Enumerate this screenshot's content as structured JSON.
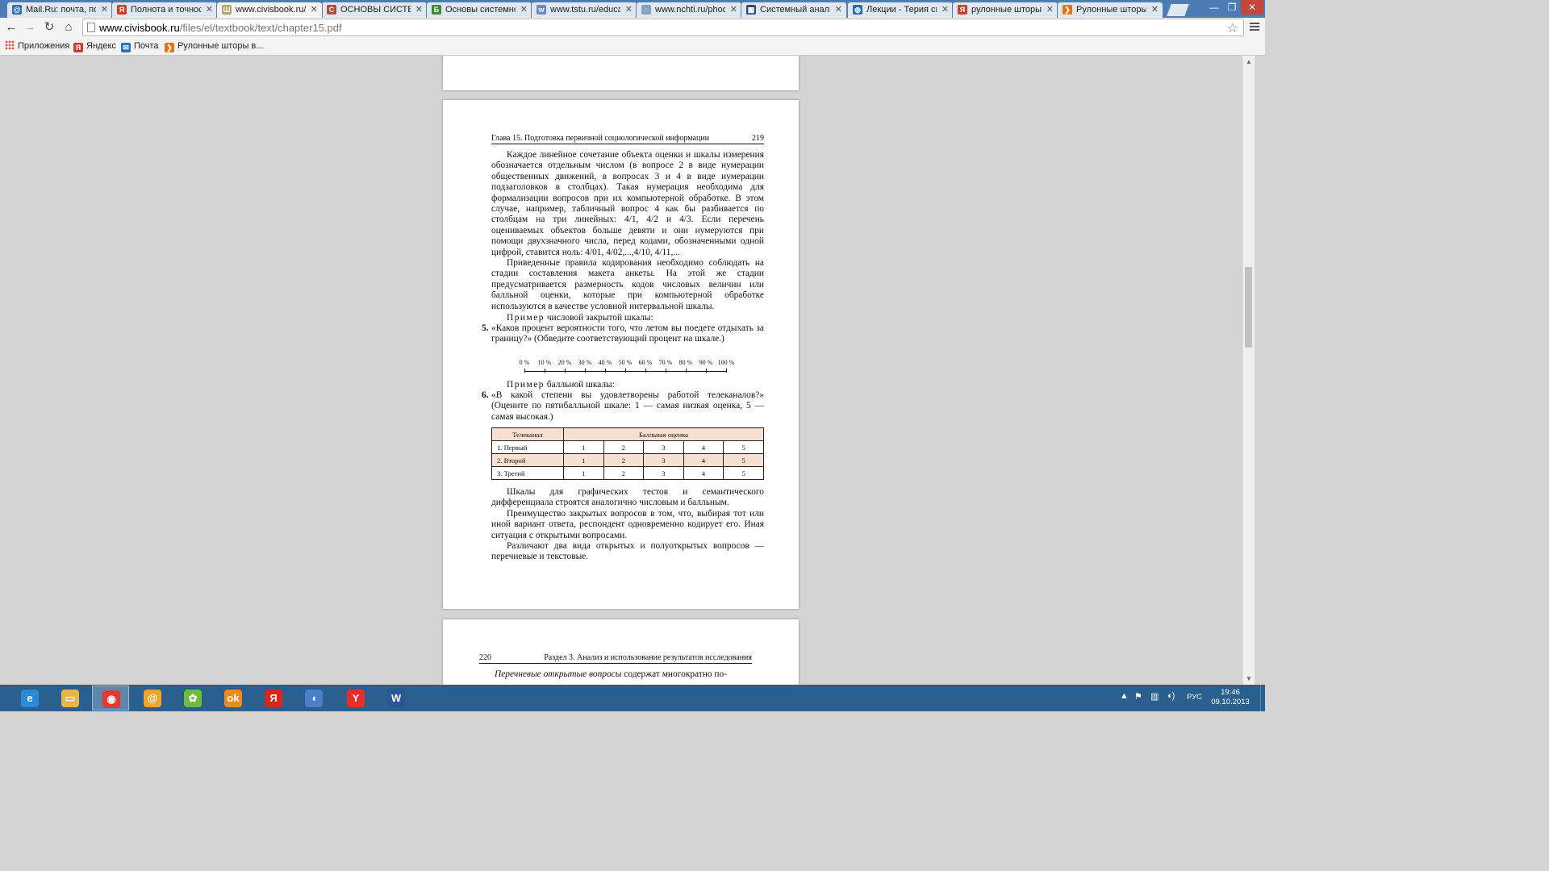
{
  "browser": {
    "tabs": [
      {
        "label": "Mail.Ru: почта, пои",
        "color": "#2f6fb5",
        "glyph": "@"
      },
      {
        "label": "Полнота и точност",
        "color": "#d43a2a",
        "glyph": "Я"
      },
      {
        "label": "www.civisbook.ru/f",
        "color": "#b7a26a",
        "glyph": "Ш"
      },
      {
        "label": "ОСНОВЫ СИСТЕМ",
        "color": "#b14a3d",
        "glyph": "С"
      },
      {
        "label": "Основы системног",
        "color": "#3d8d2f",
        "glyph": "Б"
      },
      {
        "label": "www.tstu.ru/educat",
        "color": "#6d89c7",
        "glyph": "w"
      },
      {
        "label": "www.nchti.ru/phoc",
        "color": "#8aa0c0",
        "glyph": "◌"
      },
      {
        "label": "Системный анализ",
        "color": "#2e4a7a",
        "glyph": "▦"
      },
      {
        "label": "Лекции - Терия си",
        "color": "#2a6bc0",
        "glyph": "◍"
      },
      {
        "label": "рулонные шторы",
        "color": "#d43a2a",
        "glyph": "Я"
      },
      {
        "label": "Рулонные шторы -",
        "color": "#e8730c",
        "glyph": "❯"
      }
    ],
    "active_tab": 2,
    "url_host": "www.civisbook.ru",
    "url_path": "/files/el/textbook/text/chapter15.pdf",
    "bookmarks": [
      {
        "label": "Приложения",
        "icon": "apps-icon"
      },
      {
        "label": "Яндекс",
        "icon": "yandex-icon",
        "color": "#d43a2a",
        "glyph": "Я"
      },
      {
        "label": "Почта",
        "icon": "mail-icon",
        "color": "#2f6fb5",
        "glyph": "✉"
      },
      {
        "label": "Рулонные шторы в...",
        "icon": "bookmark-icon",
        "color": "#e8730c",
        "glyph": "❯"
      }
    ]
  },
  "document": {
    "main_page": {
      "header_title": "Глава 15. Подготовка первичной социологической информации",
      "page_number": "219",
      "para1": "Каждое линейное сочетание объекта оценки и шкалы измерения обозначается отдельным числом (в вопросе 2 в виде нумерации общественных движений, в вопросах 3 и 4 в виде нумерации подзаголовков в столбцах). Такая нумерация необходима для формализации вопросов при их компьютерной обработке. В этом случае, например, табличный вопрос 4 как бы разбивается по столбцам на три линейных: 4/1, 4/2 и 4/3. Если перечень оцениваемых объектов больше девяти и они нумеруются при помощи двухзначного числа, перед кодами, обозначенными одной цифрой, ставится ноль: 4/01, 4/02,...,4/10, 4/11,...",
      "para2": "Приведенные правила кодирования необходимо соблюдать на стадии составления макета анкеты. На этой же стадии предусматривается размерность кодов числовых величин или балльной оценки, которые при компьютерной обработке используются в качестве условной интервальной шкалы.",
      "example1_spaced": "Пример",
      "example1_rest": " числовой закрытой шкалы:",
      "q5_number": "5.",
      "q5_text": "«Каков процент вероятности того, что летом вы поедете отдыхать за границу?» (Обведите соответствующий процент на шкале.)",
      "scale_ticks": [
        "0 %",
        "10 %",
        "20 %",
        "30 %",
        "40 %",
        "50 %",
        "60 %",
        "70 %",
        "80 %",
        "90 %",
        "100 %"
      ],
      "example2_spaced": "Пример",
      "example2_rest": " балльной шкалы:",
      "q6_number": "6.",
      "q6_text": "«В какой степени вы удовлетворены работой телеканалов?» (Оцените по пятибалльной шкале: 1 — самая низкая оценка, 5 — самая высокая.)",
      "table": {
        "col1_header": "Телеканал",
        "col2_header": "Балльная оценка",
        "rows": [
          {
            "name": "1. Первый",
            "scores": [
              "1",
              "2",
              "3",
              "4",
              "5"
            ]
          },
          {
            "name": "2. Второй",
            "scores": [
              "1",
              "2",
              "3",
              "4",
              "5"
            ]
          },
          {
            "name": "3. Третий",
            "scores": [
              "1",
              "2",
              "3",
              "4",
              "5"
            ]
          }
        ]
      },
      "para3": "Шкалы для графических тестов и семантического дифференциала строятся аналогично числовым и балльным.",
      "para4": "Преимущество закрытых вопросов в том, что, выбирая тот или иной вариант ответа, респондент одновременно кодирует его. Иная ситуация с открытыми вопросами.",
      "para5": "Различают два вида открытых и полуоткрытых вопросов — перечневые и текстовые."
    },
    "next_page": {
      "page_number": "220",
      "header_title": "Раздел 3. Анализ и использование результатов исследования",
      "first_line_italic": "Перечневые открытые вопросы",
      "first_line_rest": " содержат многократно по-"
    }
  },
  "scrollbar": {
    "position_fraction": 0.38
  },
  "taskbar": {
    "apps": [
      {
        "name": "internet-explorer-icon",
        "glyph": "e",
        "color": "#2a8ad8"
      },
      {
        "name": "file-explorer-icon",
        "glyph": "▭",
        "color": "#e6b84a"
      },
      {
        "name": "chrome-icon",
        "glyph": "◉",
        "color": "#e23b2e"
      },
      {
        "name": "mail-agent-icon",
        "glyph": "@",
        "color": "#f1a629"
      },
      {
        "name": "icq-icon",
        "glyph": "✿",
        "color": "#6bbd3a"
      },
      {
        "name": "odnoklassniki-icon",
        "glyph": "ok",
        "color": "#f18a1c"
      },
      {
        "name": "yandex-icon",
        "glyph": "Я",
        "color": "#d9261c"
      },
      {
        "name": "speaker-app-icon",
        "glyph": "◖",
        "color": "#4c7fc7"
      },
      {
        "name": "yandex-browser-icon",
        "glyph": "Y",
        "color": "#e82c28"
      },
      {
        "name": "word-icon",
        "glyph": "W",
        "color": "#2b579a"
      }
    ],
    "active_app": 2,
    "language": "РУС",
    "time": "19:46",
    "date": "09.10.2013"
  }
}
